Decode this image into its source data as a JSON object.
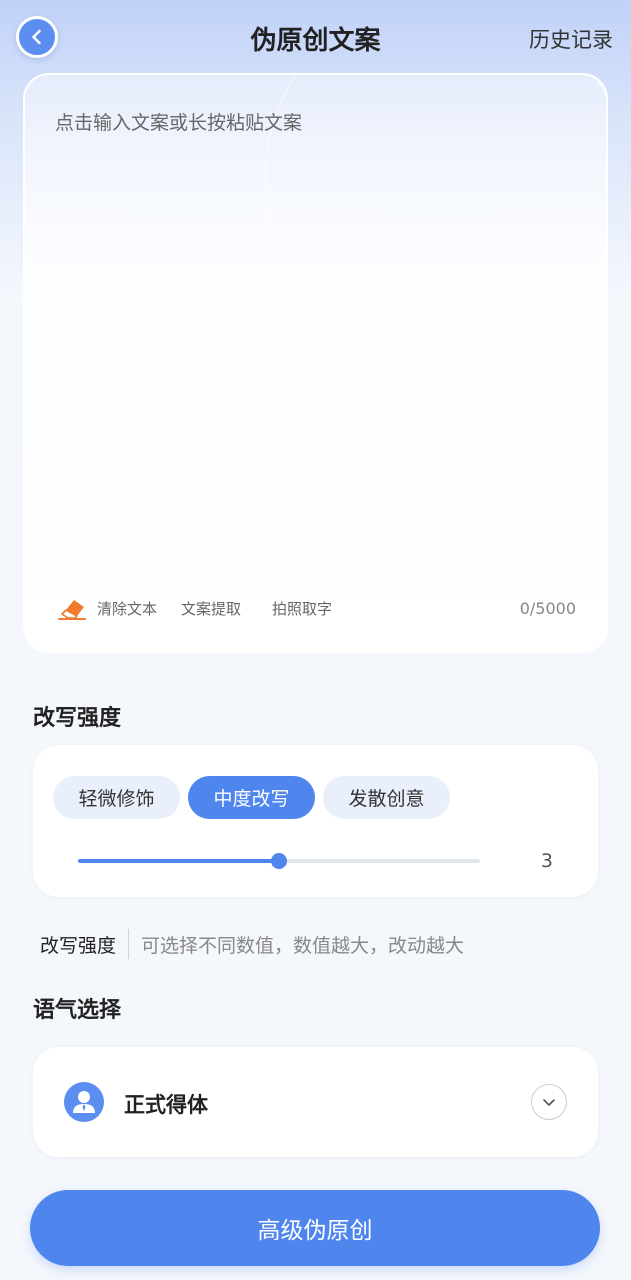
{
  "header": {
    "title": "伪原创文案",
    "history_label": "历史记录",
    "back_icon": "chevron-left-icon"
  },
  "editor": {
    "placeholder": "点击输入文案或长按粘贴文案",
    "tools": {
      "clear_label": "清除文本",
      "extract_label": "文案提取",
      "photo_label": "拍照取字",
      "clear_icon": "eraser-icon"
    },
    "counter": "0/5000"
  },
  "intensity": {
    "title": "改写强度",
    "options": [
      "轻微修饰",
      "中度改写",
      "发散创意"
    ],
    "selected_index": 1,
    "slider": {
      "value": 3,
      "value_label": "3",
      "fraction": 0.5
    },
    "hint_label": "改写强度",
    "hint_text": "可选择不同数值，数值越大，改动越大"
  },
  "tone": {
    "title": "语气选择",
    "selected": "正式得体",
    "icon": "person-icon",
    "dropdown_icon": "chevron-down-icon"
  },
  "submit": {
    "label": "高级伪原创"
  },
  "colors": {
    "accent": "#4f86ee",
    "chip_bg": "#e9f0fc",
    "eraser": "#f07a2e"
  }
}
